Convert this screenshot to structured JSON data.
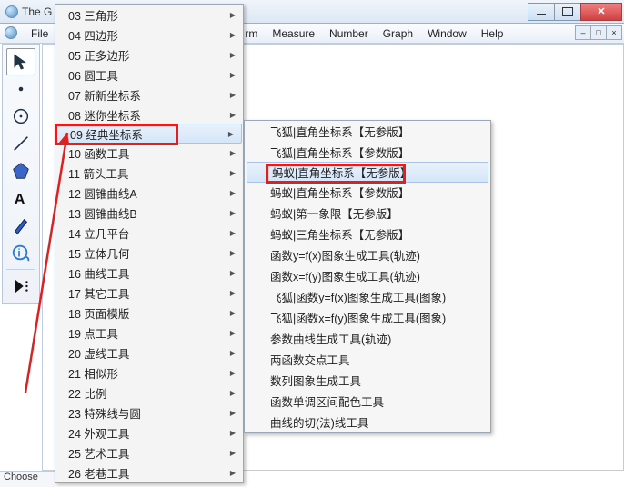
{
  "title": "The G",
  "menubar": {
    "file": "File",
    "rm": "rm",
    "measure": "Measure",
    "number": "Number",
    "graph": "Graph",
    "window": "Window",
    "help": "Help"
  },
  "status": "Choose",
  "menu1": [
    "03 三角形",
    "04 四边形",
    "05 正多边形",
    "06 圆工具",
    "07 新新坐标系",
    "08 迷你坐标系",
    "09 经典坐标系",
    "10 函数工具",
    "11 箭头工具",
    "12 圆锥曲线A",
    "13 圆锥曲线B",
    "14 立几平台",
    "15 立体几何",
    "16 曲线工具",
    "17 其它工具",
    "18 页面模版",
    "19 点工具",
    "20 虚线工具",
    "21 相似形",
    "22 比例",
    "23 特殊线与圆",
    "24 外观工具",
    "25 艺术工具",
    "26 老巷工具"
  ],
  "menu1_highlight_index": 6,
  "menu2": [
    "飞狐|直角坐标系【无参版】",
    "飞狐|直角坐标系【参数版】",
    "蚂蚁|直角坐标系【无参版】",
    "蚂蚁|直角坐标系【参数版】",
    "蚂蚁|第一象限【无参版】",
    "蚂蚁|三角坐标系【无参版】",
    "函数y=f(x)图象生成工具(轨迹)",
    "函数x=f(y)图象生成工具(轨迹)",
    "飞狐|函数y=f(x)图象生成工具(图象)",
    "飞狐|函数x=f(y)图象生成工具(图象)",
    "参数曲线生成工具(轨迹)",
    "两函数交点工具",
    "数列图象生成工具",
    "函数单调区间配色工具",
    "曲线的切(法)线工具"
  ],
  "menu2_highlight_index": 2,
  "tools": [
    "arrow-tool",
    "point-tool",
    "circle-tool",
    "line-tool",
    "polygon-tool",
    "text-tool",
    "pen-tool",
    "info-tool",
    "custom-tool"
  ]
}
